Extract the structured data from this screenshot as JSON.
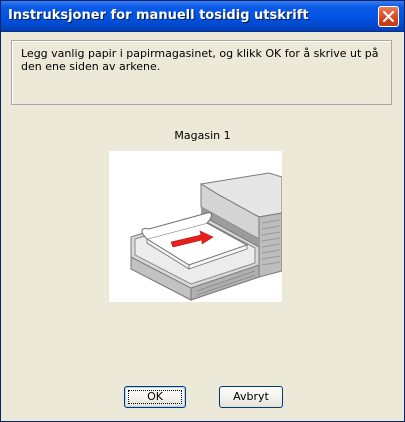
{
  "window": {
    "title": "Instruksjoner for manuell tosidig utskrift",
    "close_icon": "close-icon"
  },
  "message": {
    "text": "Legg vanlig papir i papirmagasinet, og klikk OK for å skrive ut på den ene siden av arkene."
  },
  "tray": {
    "label": "Magasin 1",
    "illustration": "printer-paper-tray-illustration"
  },
  "buttons": {
    "ok_label": "OK",
    "cancel_label": "Avbryt"
  },
  "colors": {
    "titlebar": "#0054e3",
    "dialog_background": "#ece9d8",
    "close_button": "#d4461f",
    "arrow": "#e81e1e"
  }
}
